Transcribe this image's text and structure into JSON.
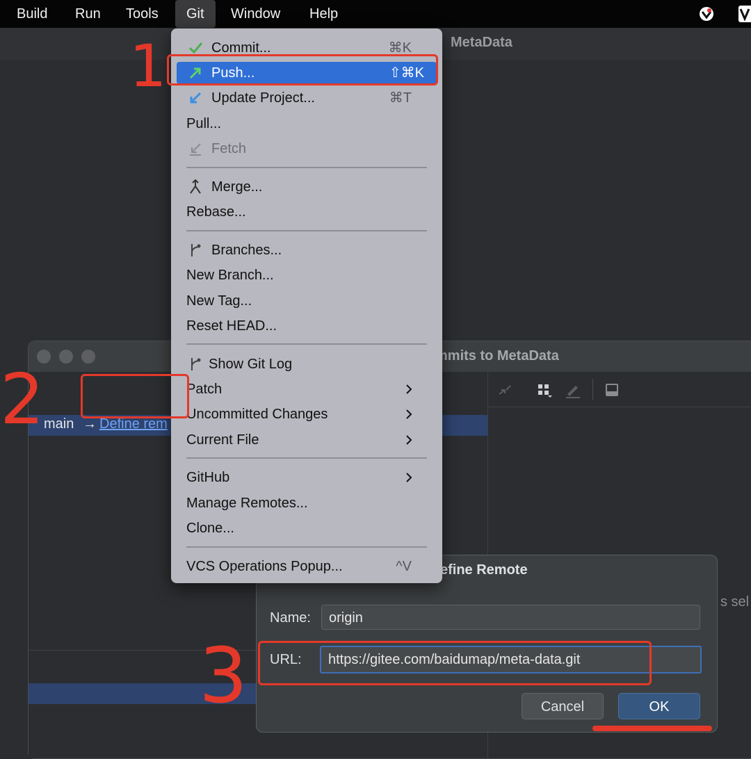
{
  "menubar": {
    "items": [
      "Build",
      "Run",
      "Tools",
      "Git",
      "Window",
      "Help"
    ]
  },
  "ide": {
    "project_title": "MetaData"
  },
  "git_menu": {
    "commit": {
      "label": "Commit...",
      "shortcut": "⌘K"
    },
    "push": {
      "label": "Push...",
      "shortcut": "⇧⌘K"
    },
    "update_project": {
      "label": "Update Project...",
      "shortcut": "⌘T"
    },
    "pull": {
      "label": "Pull..."
    },
    "fetch": {
      "label": "Fetch"
    },
    "merge": {
      "label": "Merge..."
    },
    "rebase": {
      "label": "Rebase..."
    },
    "branches": {
      "label": "Branches..."
    },
    "new_branch": {
      "label": "New Branch..."
    },
    "new_tag": {
      "label": "New Tag..."
    },
    "reset_head": {
      "label": "Reset HEAD..."
    },
    "show_git_log": {
      "label": "Show Git Log"
    },
    "patch": {
      "label": "Patch"
    },
    "uncommitted_changes": {
      "label": "Uncommitted Changes"
    },
    "current_file": {
      "label": "Current File"
    },
    "github": {
      "label": "GitHub"
    },
    "manage_remotes": {
      "label": "Manage Remotes..."
    },
    "clone": {
      "label": "Clone..."
    },
    "vcs_operations": {
      "label": "VCS Operations Popup...",
      "shortcut": "^V"
    }
  },
  "push_dialog": {
    "title": "mmits to MetaData",
    "branch": "main",
    "arrow": "→",
    "define_remote_link": "Define rem",
    "right_hint": "s sel"
  },
  "remote_dialog": {
    "title": "efine Remote",
    "name_label": "Name:",
    "name_value": "origin",
    "url_label": "URL:",
    "url_value": "https://gitee.com/baidumap/meta-data.git",
    "cancel_label": "Cancel",
    "ok_label": "OK"
  },
  "colors": {
    "menu_bg": "#b8b8c0",
    "menu_highlight": "#2f6fd6",
    "annotation": "#e4392a",
    "link": "#6fa3f7",
    "ok_button": "#365880"
  },
  "annotations": {
    "step_1": "1",
    "step_2": "2",
    "step_3": "3"
  }
}
